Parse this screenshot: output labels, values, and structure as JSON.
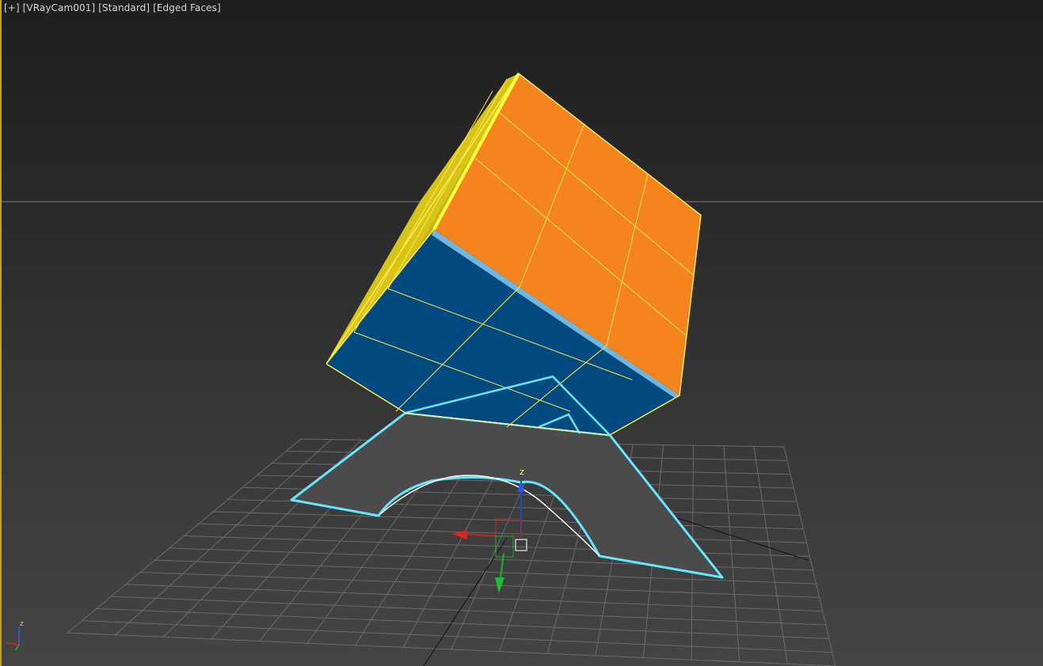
{
  "viewport": {
    "menus": [
      {
        "label": "[+]"
      },
      {
        "label": "[VRayCam001]"
      },
      {
        "label": "[Standard]"
      },
      {
        "label": "[Edged Faces]"
      }
    ]
  },
  "gizmo": {
    "z_label": "z",
    "axis_colors": {
      "x": "#cc2222",
      "y": "#22aa33",
      "z": "#2244cc"
    }
  },
  "axis_tripod": {
    "z_label": "z"
  },
  "colors": {
    "cube_top": "#f5841f",
    "cube_front": "#004a80",
    "cube_side": "#d8c418",
    "cube_edges": "#ffe94a",
    "stand": "#4b4b4b",
    "selection": "#66e6ff",
    "grid": "#6a6a6a"
  }
}
